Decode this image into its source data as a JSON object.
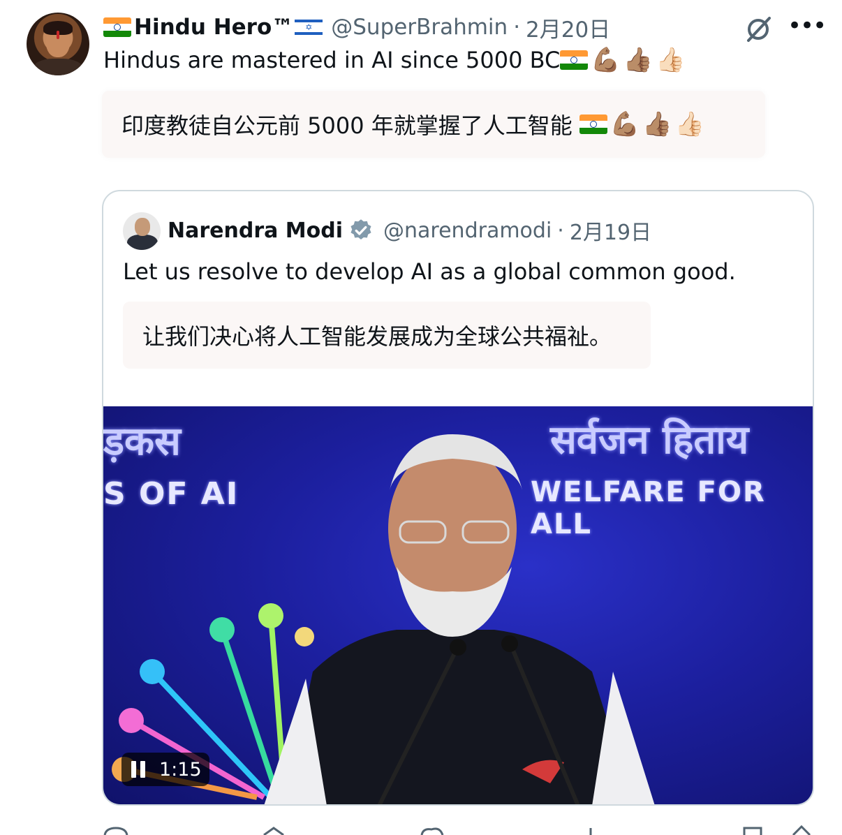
{
  "tweet": {
    "author_name": "Hindu Hero™",
    "handle": "@SuperBrahmin",
    "date": "2月20日",
    "text": "Hindus are mastered in AI since 5000 BC",
    "translation": "印度教徒自公元前 5000 年就掌握了人工智能",
    "emojis": [
      "💪🏽",
      "👍🏽",
      "👍🏻"
    ]
  },
  "quoted": {
    "author_name": "Narendra Modi",
    "handle": "@narendramodi",
    "date": "2月19日",
    "text": "Let us resolve to develop AI as a global common good.",
    "translation": "让我们决心将人工智能发展成为全球公共福祉。",
    "video": {
      "time": "1:15",
      "banner_left": "ड़कस",
      "banner_left_ai": "S OF AI",
      "banner_right": "सर्वजन हिताय",
      "banner_right_ai": "WELFARE FOR ALL"
    }
  },
  "colors": {
    "text": "#0f1419",
    "secondary": "#536471",
    "verified": "#829aab",
    "translation_bg": "#fbf7f6",
    "border": "#cfd9de"
  },
  "icons": [
    "grok-icon",
    "more-icon",
    "verified-badge-icon",
    "pause-icon"
  ]
}
